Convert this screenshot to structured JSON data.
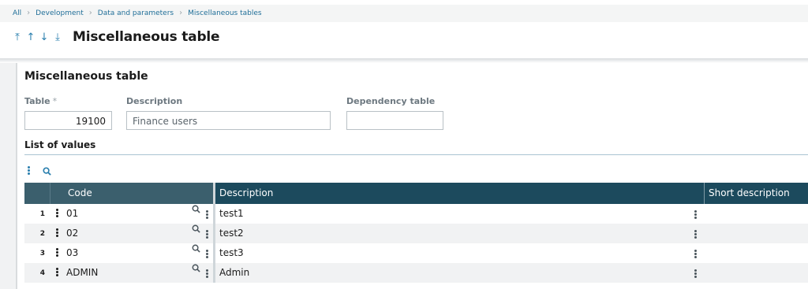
{
  "breadcrumb": {
    "items": [
      "All",
      "Development",
      "Data and parameters",
      "Miscellaneous tables"
    ]
  },
  "header": {
    "title": "Miscellaneous table",
    "nav_icons": [
      "first-record-icon",
      "previous-record-icon",
      "next-record-icon",
      "last-record-icon"
    ]
  },
  "section": {
    "title": "Miscellaneous table",
    "table_label": "Table",
    "table_required_mark": "*",
    "table_value": "19100",
    "description_label": "Description",
    "description_value": "Finance users",
    "dependency_label": "Dependency table",
    "dependency_value": ""
  },
  "list": {
    "title": "List of values",
    "columns": {
      "code": "Code",
      "description": "Description",
      "short_description": "Short description"
    },
    "rows": [
      {
        "num": "1",
        "code": "01",
        "description": "test1",
        "short": ""
      },
      {
        "num": "2",
        "code": "02",
        "description": "test2",
        "short": ""
      },
      {
        "num": "3",
        "code": "03",
        "description": "test3",
        "short": ""
      },
      {
        "num": "4",
        "code": "ADMIN",
        "description": "Admin",
        "short": ""
      }
    ]
  },
  "colors": {
    "accent": "#2a7fae",
    "grid_header_dark": "#1c4a5d",
    "grid_header_light": "#3b5f6d"
  }
}
